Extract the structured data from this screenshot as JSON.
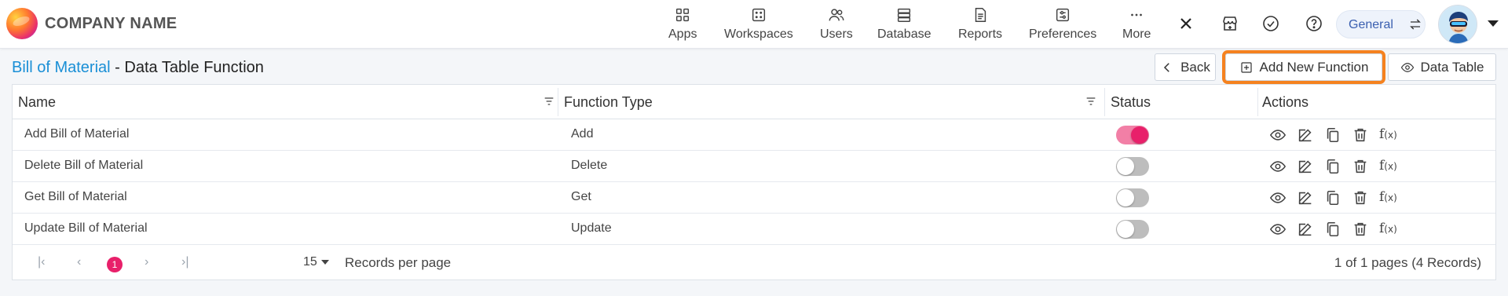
{
  "brand": {
    "company_name": "COMPANY NAME"
  },
  "nav": [
    {
      "label": "Apps",
      "icon": "apps-grid-icon"
    },
    {
      "label": "Workspaces",
      "icon": "workspaces-icon"
    },
    {
      "label": "Users",
      "icon": "users-icon"
    },
    {
      "label": "Database",
      "icon": "database-icon"
    },
    {
      "label": "Reports",
      "icon": "reports-icon"
    },
    {
      "label": "Preferences",
      "icon": "preferences-icon"
    },
    {
      "label": "More",
      "icon": "more-dots-icon"
    }
  ],
  "toolbar_icons": [
    "close-icon",
    "store-icon",
    "check-circle-icon",
    "help-icon"
  ],
  "workspace_switcher": {
    "label": "General"
  },
  "page": {
    "breadcrumb": "Bill of Material",
    "separator": " - ",
    "title": "Data Table Function"
  },
  "buttons": {
    "back": "Back",
    "add_new": "Add New Function",
    "data_table": "Data Table"
  },
  "table": {
    "columns": {
      "name": "Name",
      "function_type": "Function Type",
      "status": "Status",
      "actions": "Actions"
    },
    "rows": [
      {
        "name": "Add Bill of Material",
        "function_type": "Add",
        "status_on": true
      },
      {
        "name": "Delete Bill of Material",
        "function_type": "Delete",
        "status_on": false
      },
      {
        "name": "Get Bill of Material",
        "function_type": "Get",
        "status_on": false
      },
      {
        "name": "Update Bill of Material",
        "function_type": "Update",
        "status_on": false
      }
    ],
    "row_actions": [
      "view-icon",
      "edit-icon",
      "copy-icon",
      "delete-icon",
      "function-icon"
    ],
    "fx_label": "f",
    "fx_sub": "(x)"
  },
  "pagination": {
    "current_page": "1",
    "page_size": "15",
    "records_per_page_label": "Records per page",
    "summary": "1 of 1 pages (4 Records)"
  },
  "colors": {
    "accent": "#1a8fd6",
    "toggle_on": "#e8206a",
    "highlight": "#f5821f"
  }
}
